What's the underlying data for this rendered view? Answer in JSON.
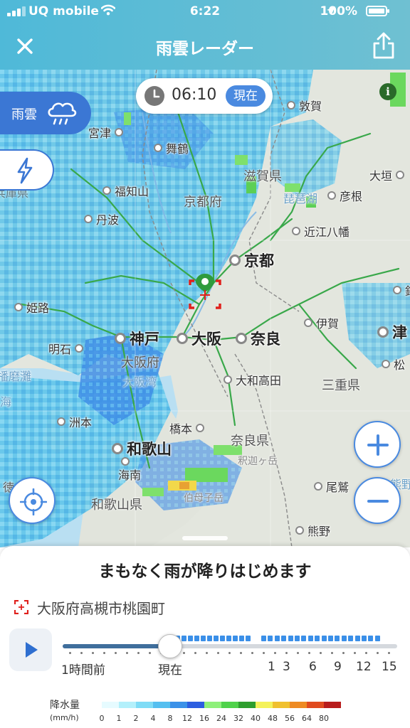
{
  "status_bar": {
    "carrier": "UQ mobile",
    "time": "6:22",
    "battery": "100%"
  },
  "header": {
    "title": "雨雲レーダー",
    "close_icon": "close-icon",
    "share_icon": "share-icon"
  },
  "map": {
    "time_display": {
      "time": "06:10",
      "now_badge": "現在"
    },
    "layer_buttons": {
      "rain_label": "雨雲",
      "rain_icon": "rain-cloud-icon",
      "lightning_icon": "lightning-icon"
    },
    "info_icon_label": "i",
    "cities": [
      {
        "name": "宮津"
      },
      {
        "name": "舞鶴"
      },
      {
        "name": "福知山"
      },
      {
        "name": "丹波"
      },
      {
        "name": "敦賀"
      },
      {
        "name": "大垣"
      },
      {
        "name": "彦根"
      },
      {
        "name": "近江八幡"
      },
      {
        "name": "京都"
      },
      {
        "name": "姫路"
      },
      {
        "name": "神戸"
      },
      {
        "name": "大阪"
      },
      {
        "name": "奈良"
      },
      {
        "name": "伊賀"
      },
      {
        "name": "津"
      },
      {
        "name": "松"
      },
      {
        "name": "明石"
      },
      {
        "name": "大和高田"
      },
      {
        "name": "洲本"
      },
      {
        "name": "橋本"
      },
      {
        "name": "和歌山"
      },
      {
        "name": "海南"
      },
      {
        "name": "尾鷲"
      },
      {
        "name": "熊野"
      },
      {
        "name": "鈴"
      }
    ],
    "prefectures": [
      {
        "name": "滋賀県"
      },
      {
        "name": "京都府"
      },
      {
        "name": "大阪府"
      },
      {
        "name": "三重県"
      },
      {
        "name": "奈良県"
      },
      {
        "name": "和歌山県"
      },
      {
        "name": "兵庫県"
      },
      {
        "name": "琵琶湖"
      },
      {
        "name": "大阪湾"
      },
      {
        "name": "播磨灘"
      },
      {
        "name": "海"
      },
      {
        "name": "徳"
      },
      {
        "name": "熊野"
      },
      {
        "name": "釈迦ヶ岳"
      },
      {
        "name": "伯母子岳"
      }
    ]
  },
  "sheet": {
    "headline": "まもなく雨が降りはじめます",
    "address": "大阪府高槻市桃園町",
    "timeline": {
      "labels": [
        "1時間前",
        "現在",
        "1",
        "3",
        "6",
        "9",
        "12",
        "15"
      ],
      "position": 0.325
    },
    "legend": {
      "title": "降水量",
      "unit": "(mm/h)",
      "values": [
        "0",
        "1",
        "2",
        "4",
        "8",
        "12",
        "16",
        "24",
        "32",
        "40",
        "48",
        "56",
        "64",
        "80"
      ],
      "colors": [
        "#e6fbff",
        "#b3f0fb",
        "#7fdcf6",
        "#55bff0",
        "#3a91e8",
        "#2c5ee0",
        "#8ef07a",
        "#4fd24a",
        "#2e9e2e",
        "#f4f25a",
        "#f0c02e",
        "#ee8a22",
        "#e04a1e",
        "#b81c1c"
      ]
    }
  }
}
